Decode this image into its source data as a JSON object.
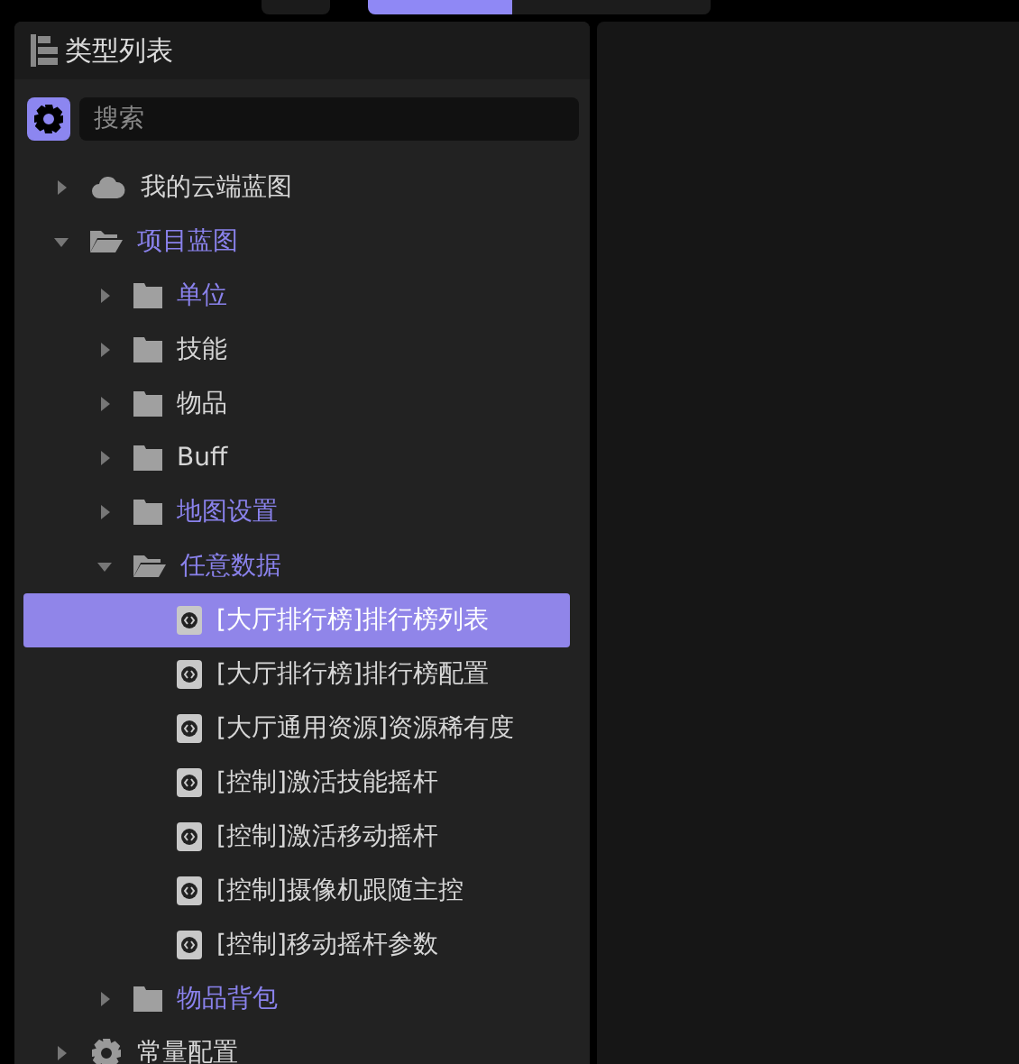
{
  "top_bar": {
    "modes": [
      {
        "selected": true
      },
      {
        "selected": false
      }
    ]
  },
  "panel": {
    "title": "类型列表",
    "search": {
      "placeholder": "搜索"
    },
    "tree": [
      {
        "label": "我的云端蓝图",
        "kind": "cloud",
        "expanded": false,
        "accent": false,
        "selected": false
      },
      {
        "label": "项目蓝图",
        "kind": "folder",
        "expanded": true,
        "accent": true,
        "selected": false,
        "children": [
          {
            "label": "单位",
            "kind": "folder",
            "expanded": false,
            "accent": true,
            "selected": false
          },
          {
            "label": "技能",
            "kind": "folder",
            "expanded": false,
            "accent": false,
            "selected": false
          },
          {
            "label": "物品",
            "kind": "folder",
            "expanded": false,
            "accent": false,
            "selected": false
          },
          {
            "label": "Buff",
            "kind": "folder",
            "expanded": false,
            "accent": false,
            "selected": false
          },
          {
            "label": "地图设置",
            "kind": "folder",
            "expanded": false,
            "accent": true,
            "selected": false
          },
          {
            "label": "任意数据",
            "kind": "folder",
            "expanded": true,
            "accent": true,
            "selected": false,
            "children": [
              {
                "label": "[大厅排行榜]排行榜列表",
                "kind": "file",
                "accent": false,
                "selected": true
              },
              {
                "label": "[大厅排行榜]排行榜配置",
                "kind": "file",
                "accent": false,
                "selected": false
              },
              {
                "label": "[大厅通用资源]资源稀有度",
                "kind": "file",
                "accent": false,
                "selected": false
              },
              {
                "label": "[控制]激活技能摇杆",
                "kind": "file",
                "accent": false,
                "selected": false
              },
              {
                "label": "[控制]激活移动摇杆",
                "kind": "file",
                "accent": false,
                "selected": false
              },
              {
                "label": "[控制]摄像机跟随主控",
                "kind": "file",
                "accent": false,
                "selected": false
              },
              {
                "label": "[控制]移动摇杆参数",
                "kind": "file",
                "accent": false,
                "selected": false
              }
            ]
          },
          {
            "label": "物品背包",
            "kind": "folder",
            "expanded": false,
            "accent": true,
            "selected": false
          }
        ]
      },
      {
        "label": "常量配置",
        "kind": "gear",
        "expanded": false,
        "accent": false,
        "selected": false
      }
    ]
  }
}
